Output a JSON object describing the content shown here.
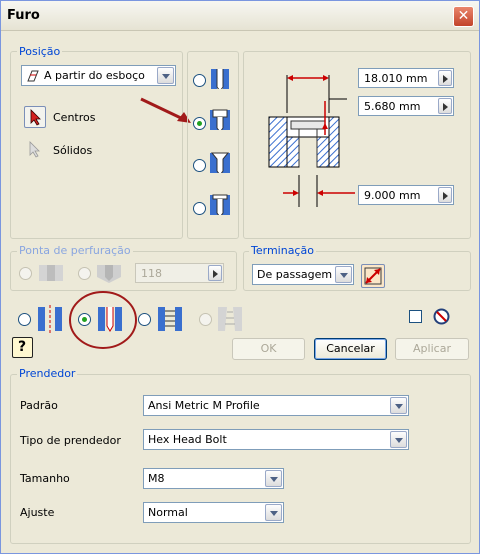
{
  "window": {
    "title": "Furo",
    "close_glyph": "✕"
  },
  "posicao": {
    "label": "Posição",
    "placement": "A partir do esboço",
    "centros": "Centros",
    "solidos": "Sólidos"
  },
  "hole_type": {
    "selected": "counterbore"
  },
  "dimensions": {
    "d1": "18.010 mm",
    "d2": "5.680 mm",
    "d3": "9.000 mm"
  },
  "ponta": {
    "label": "Ponta de perfuração",
    "angle": "118"
  },
  "terminacao": {
    "label": "Terminação",
    "value": "De passagem"
  },
  "thread_type": {
    "selected": "clearance"
  },
  "buttons": {
    "ok": "OK",
    "cancelar": "Cancelar",
    "aplicar": "Aplicar",
    "help": "?"
  },
  "prendedor": {
    "label": "Prendedor",
    "padrao_label": "Padrão",
    "padrao_value": "Ansi Metric M Profile",
    "tipo_label": "Tipo de prendedor",
    "tipo_value": "Hex Head Bolt",
    "tamanho_label": "Tamanho",
    "tamanho_value": "M8",
    "ajuste_label": "Ajuste",
    "ajuste_value": "Normal"
  },
  "colors": {
    "accent_blue": "#0046d5",
    "annotation_red": "#a11a1a",
    "hatch_blue": "#3a6fcf"
  }
}
